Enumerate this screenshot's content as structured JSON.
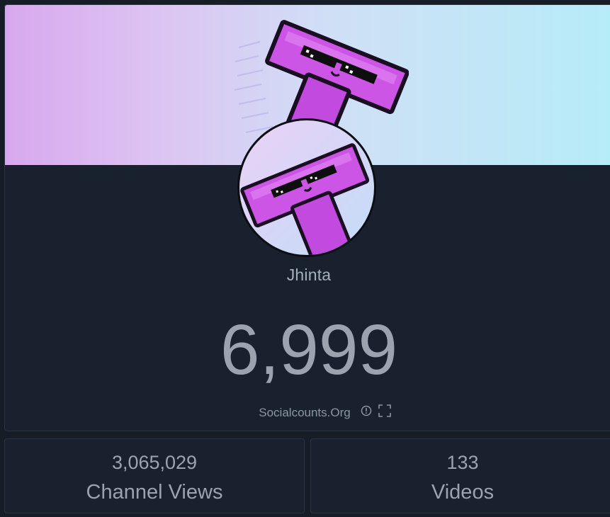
{
  "channel": {
    "name": "Jhinta",
    "subscriber_count": "6,999"
  },
  "source": {
    "label": "Socialcounts.Org",
    "info_icon": "info-circle-icon",
    "fullscreen_icon": "fullscreen-icon"
  },
  "stats": [
    {
      "value": "3,065,029",
      "label": "Channel Views"
    },
    {
      "value": "133",
      "label": "Videos"
    }
  ],
  "colors": {
    "background": "#161d27",
    "card": "#18212d",
    "text": "#9aa3ae",
    "mascot": "#cc55e6"
  }
}
